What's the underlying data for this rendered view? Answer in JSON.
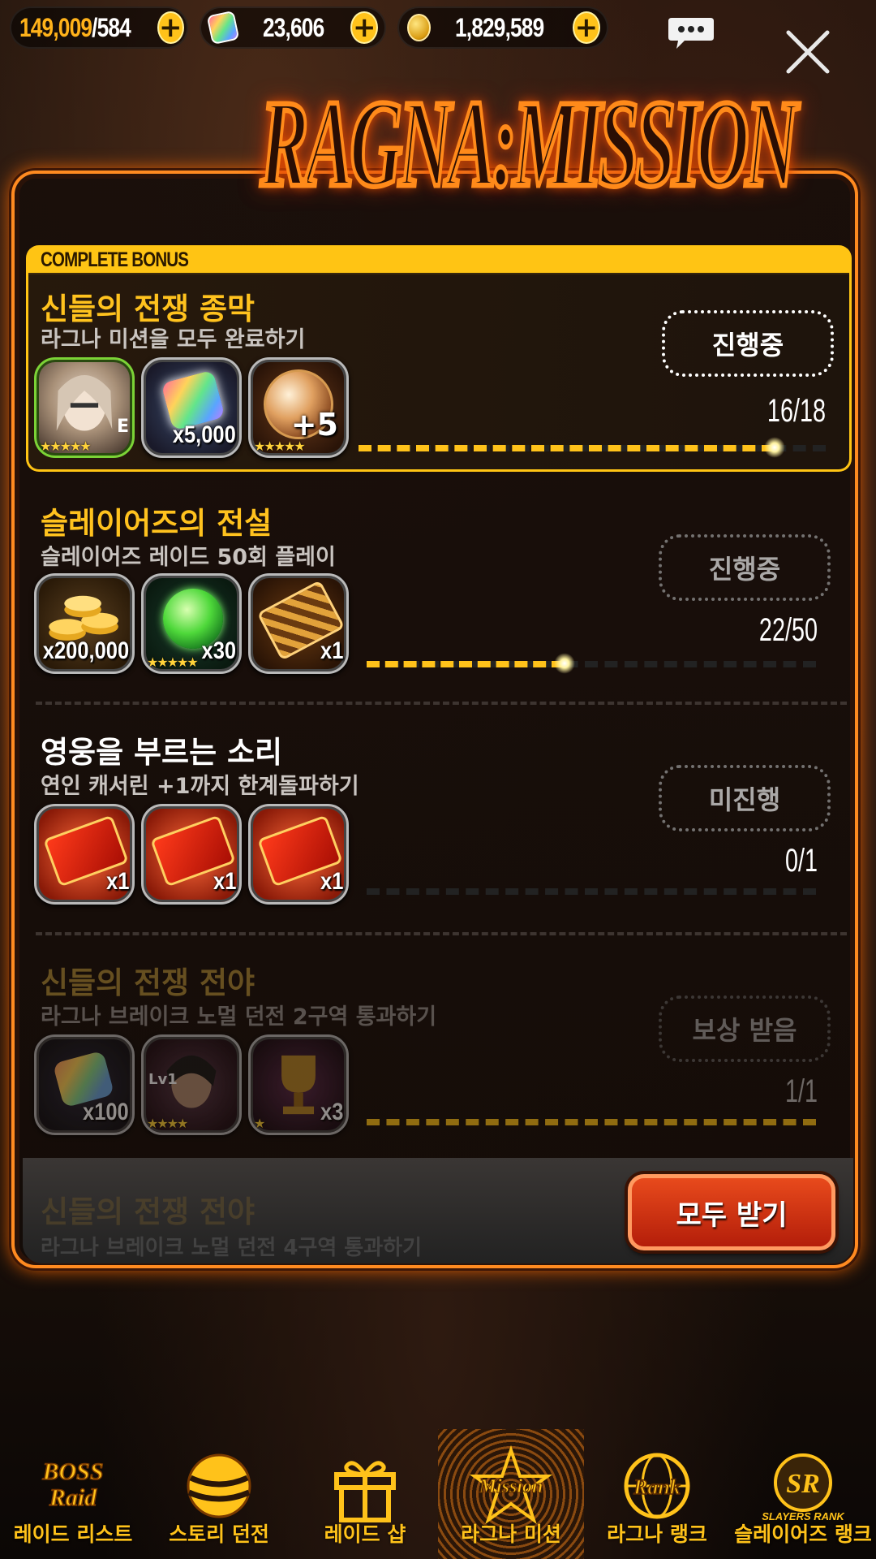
{
  "currency": {
    "stamina": {
      "current": "149,009",
      "max": "/584"
    },
    "gems": "23,606",
    "gold": "1,829,589"
  },
  "title": "RAGNA:MISSION",
  "complete_bonus_label": "COMPLETE BONUS",
  "missions": [
    {
      "title": "신들의 전쟁 종막",
      "desc": "라그나 미션을 모두 완료하기",
      "status": "진행중",
      "progress_text": "16/18",
      "progress": 0.89,
      "rewards": [
        {
          "icon": "hero-portrait-icon",
          "qty": "E",
          "stars": "★★★★★"
        },
        {
          "icon": "rainbow-gem-icon",
          "qty": "x5,000",
          "stars": ""
        },
        {
          "icon": "enhance-orb-icon",
          "qty": "+5",
          "stars": "★★★★★"
        }
      ]
    },
    {
      "title": "슬레이어즈의 전설",
      "desc": "슬레이어즈 레이드 50회 플레이",
      "status": "진행중",
      "progress_text": "22/50",
      "progress": 0.44,
      "rewards": [
        {
          "icon": "gold-coins-icon",
          "qty": "x200,000",
          "stars": ""
        },
        {
          "icon": "green-gem-icon",
          "qty": "x30",
          "stars": "★★★★★"
        },
        {
          "icon": "ticket-icon",
          "qty": "x1",
          "stars": ""
        }
      ]
    },
    {
      "title": "영웅을 부르는 소리",
      "desc": "연인 캐서린 +1까지 한계돌파하기",
      "status": "미진행",
      "progress_text": "0/1",
      "progress": 0,
      "rewards": [
        {
          "icon": "summon-ticket-icon",
          "qty": "x1",
          "stars": ""
        },
        {
          "icon": "summon-ticket-icon",
          "qty": "x1",
          "stars": ""
        },
        {
          "icon": "summon-ticket-icon",
          "qty": "x1",
          "stars": ""
        }
      ]
    },
    {
      "title": "신들의 전쟁 전야",
      "desc": "라그나 브레이크 노멀 던전 2구역 통과하기",
      "status": "보상 받음",
      "progress_text": "1/1",
      "progress": 1,
      "rewards": [
        {
          "icon": "rainbow-gem-icon",
          "qty": "x100",
          "stars": ""
        },
        {
          "icon": "hero-portrait-icon",
          "qty": "Lv1",
          "stars": "★★★★"
        },
        {
          "icon": "trophy-icon",
          "qty": "x3",
          "stars": "★"
        }
      ]
    }
  ],
  "ghost_mission": {
    "title": "신들의 전쟁 전야",
    "desc": "라그나 브레이크 노멀 던전 4구역 통과하기"
  },
  "claim_all_label": "모두 받기",
  "nav": [
    {
      "icon": "boss-raid-icon",
      "label": "레이드 리스트",
      "icon_text": "BOSS Raid"
    },
    {
      "icon": "story-dungeon-icon",
      "label": "스토리 던전",
      "icon_text": ""
    },
    {
      "icon": "gift-box-icon",
      "label": "레이드 샵",
      "icon_text": ""
    },
    {
      "icon": "mission-star-icon",
      "label": "라그나 미션",
      "icon_text": "Mission"
    },
    {
      "icon": "rank-globe-icon",
      "label": "라그나 랭크",
      "icon_text": "Rank"
    },
    {
      "icon": "slayers-rank-icon",
      "label": "슬레이어즈 랭크",
      "icon_text": "SLAYERS RANK"
    }
  ],
  "active_nav": "라그나 미션",
  "colors": {
    "accent": "#ffc21a",
    "panel_border": "#ff8a20",
    "claim_button": "#d8361a"
  }
}
